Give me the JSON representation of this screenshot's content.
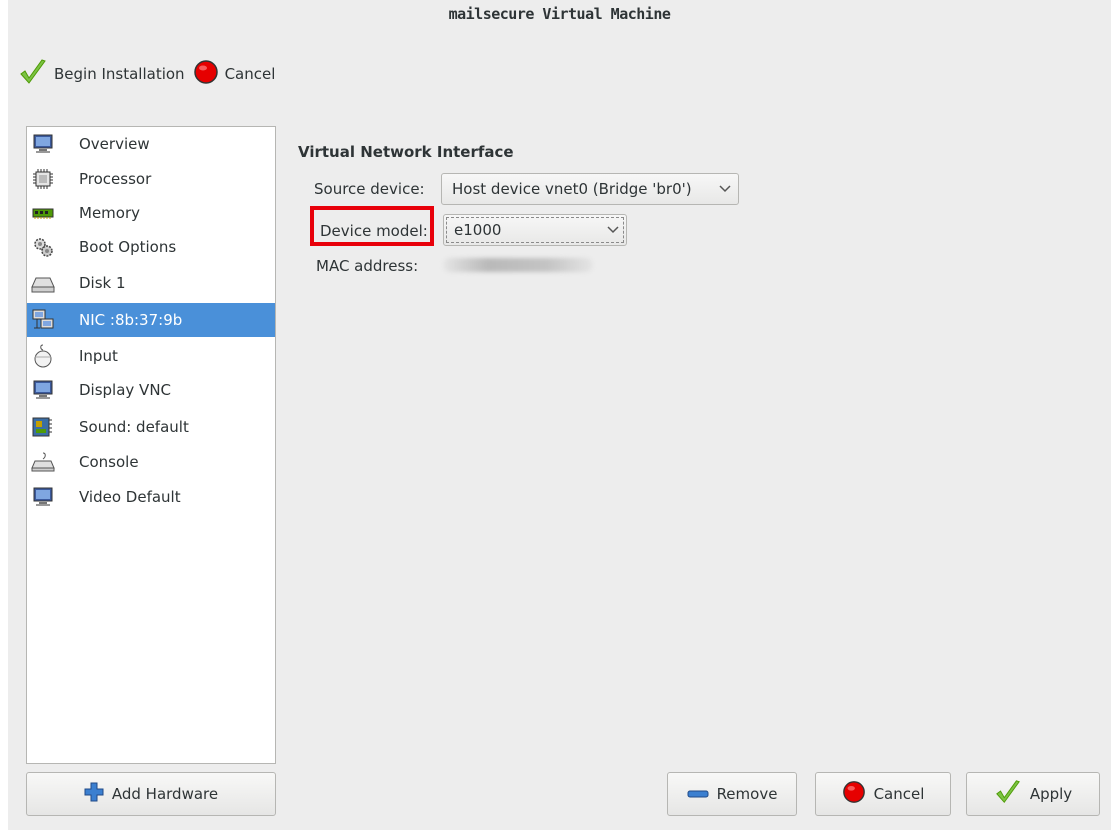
{
  "window": {
    "title": "mailsecure Virtual Machine"
  },
  "toolbar": {
    "begin_label": "Begin Installation",
    "cancel_label": "Cancel"
  },
  "sidebar": {
    "items": [
      {
        "label": "Overview",
        "icon": "monitor-icon"
      },
      {
        "label": "Processor",
        "icon": "cpu-icon"
      },
      {
        "label": "Memory",
        "icon": "memory-icon"
      },
      {
        "label": "Boot Options",
        "icon": "gears-icon"
      },
      {
        "label": "Disk 1",
        "icon": "disk-icon"
      },
      {
        "label": "NIC :8b:37:9b",
        "icon": "network-icon",
        "selected": true
      },
      {
        "label": "Input",
        "icon": "mouse-icon"
      },
      {
        "label": "Display VNC",
        "icon": "monitor-icon"
      },
      {
        "label": "Sound: default",
        "icon": "sound-card-icon"
      },
      {
        "label": "Console",
        "icon": "console-icon"
      },
      {
        "label": "Video Default",
        "icon": "monitor-icon"
      }
    ],
    "add_hardware_label": "Add Hardware"
  },
  "detail": {
    "section_title": "Virtual Network Interface",
    "source_device_label": "Source device:",
    "source_device_value": "Host device vnet0 (Bridge 'br0')",
    "device_model_label": "Device model:",
    "device_model_value": "e1000",
    "mac_address_label": "MAC address:"
  },
  "buttons": {
    "remove_label": "Remove",
    "cancel_label": "Cancel",
    "apply_label": "Apply"
  },
  "colors": {
    "selection": "#4a90d9",
    "highlight": "#e8000a",
    "window_bg": "#ededed"
  }
}
